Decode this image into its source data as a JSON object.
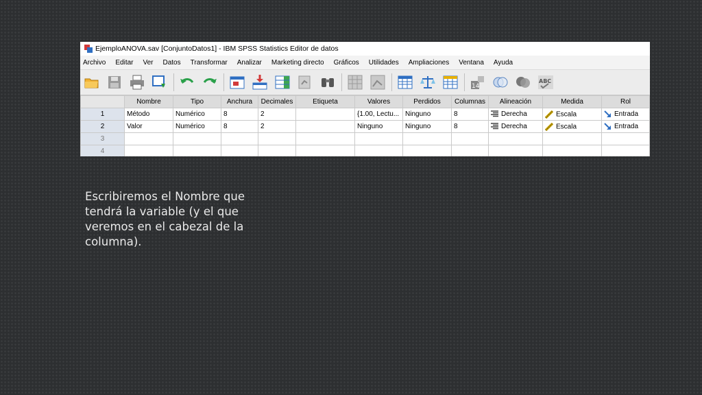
{
  "window": {
    "title": "EjemploANOVA.sav [ConjuntoDatos1] - IBM SPSS Statistics Editor de datos"
  },
  "menu": [
    "Archivo",
    "Editar",
    "Ver",
    "Datos",
    "Transformar",
    "Analizar",
    "Marketing directo",
    "Gráficos",
    "Utilidades",
    "Ampliaciones",
    "Ventana",
    "Ayuda"
  ],
  "toolbar": {
    "icons": [
      "open-folder-icon",
      "save-icon",
      "print-icon",
      "recall-dialog-icon",
      "undo-icon",
      "redo-icon",
      "goto-case-icon",
      "goto-variable-icon",
      "variables-icon",
      "run-descriptives-icon",
      "find-icon",
      "insert-cases-icon",
      "insert-variable-icon",
      "split-file-icon",
      "weight-cases-icon",
      "select-cases-icon",
      "value-labels-icon",
      "use-variable-sets-icon",
      "show-all-variables-icon",
      "spell-check-icon"
    ]
  },
  "grid": {
    "headers": [
      "Nombre",
      "Tipo",
      "Anchura",
      "Decimales",
      "Etiqueta",
      "Valores",
      "Perdidos",
      "Columnas",
      "Alineación",
      "Medida",
      "Rol"
    ],
    "rows": [
      {
        "num": "1",
        "nombre": "Método",
        "tipo": "Numérico",
        "anchura": "8",
        "decimales": "2",
        "etiqueta": "",
        "valores": "{1.00, Lectu...",
        "perdidos": "Ninguno",
        "columnas": "8",
        "alineacion": "Derecha",
        "medida": "Escala",
        "rol": "Entrada"
      },
      {
        "num": "2",
        "nombre": "Valor",
        "tipo": "Numérico",
        "anchura": "8",
        "decimales": "2",
        "etiqueta": "",
        "valores": "Ninguno",
        "perdidos": "Ninguno",
        "columnas": "8",
        "alineacion": "Derecha",
        "medida": "Escala",
        "rol": "Entrada"
      }
    ],
    "empty_rows": [
      "3",
      "4"
    ]
  },
  "caption": "Escribiremos el Nombre que tendrá la variable (y el que veremos en el cabezal de la columna).",
  "colors": {
    "background": "#2d2f31",
    "row_header": "#dde3ec",
    "column_header": "#dcdcdc",
    "caption_text": "#e9e9e9"
  }
}
